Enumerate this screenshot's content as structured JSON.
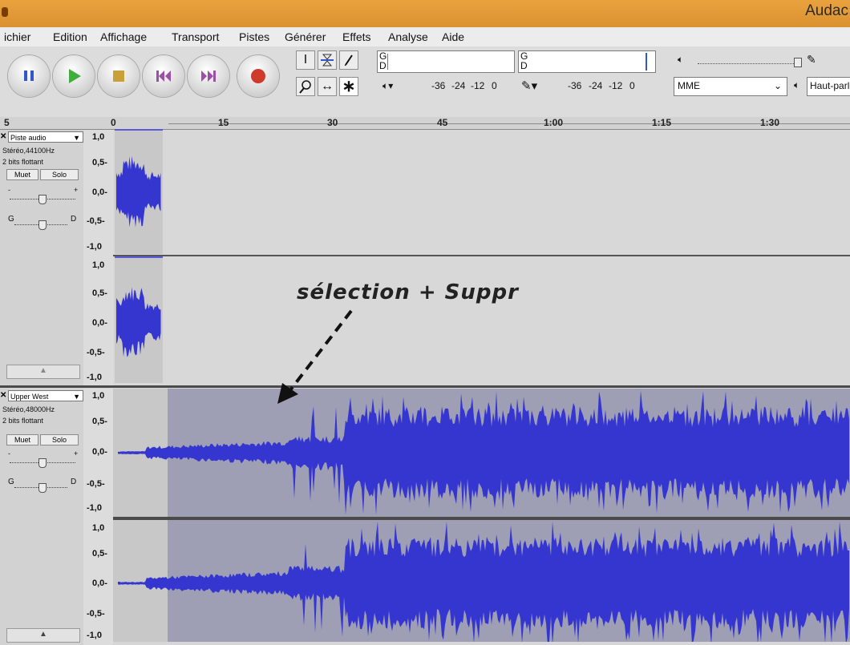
{
  "window": {
    "title": "Audac"
  },
  "menu": [
    "ichier",
    "Edition",
    "Affichage",
    "Transport",
    "Pistes",
    "Générer",
    "Effets",
    "Analyse",
    "Aide"
  ],
  "meter": {
    "ticks_play": [
      "-36",
      "-24",
      "-12",
      "0"
    ],
    "ticks_record": [
      "-36",
      "-24",
      "-12",
      "0"
    ],
    "channel_g": "G",
    "channel_d": "D"
  },
  "device": {
    "host": "MME",
    "output": "Haut-parleu"
  },
  "ruler": [
    "5",
    "0",
    "15",
    "30",
    "45",
    "1:00",
    "1:15",
    "1:30"
  ],
  "scale_labels": [
    "1,0",
    "0,5-",
    "0,0-",
    "-0,5-",
    "-1,0"
  ],
  "tracks": [
    {
      "name": "Piste audio",
      "info1": "Stéréo,44100Hz",
      "info2": "2 bits flottant",
      "mute": "Muet",
      "solo": "Solo",
      "gain_minus": "-",
      "gain_plus": "+",
      "pan_left": "G",
      "pan_right": "D"
    },
    {
      "name": "Upper West",
      "info1": "Stéréo,48000Hz",
      "info2": "2 bits flottant",
      "mute": "Muet",
      "solo": "Solo",
      "gain_minus": "-",
      "gain_plus": "+",
      "pan_left": "G",
      "pan_right": "D"
    }
  ],
  "annotation": {
    "text": "sélection + Suppr"
  },
  "colors": {
    "waveform": "#3535d0",
    "titlebar": "#e09a36",
    "selection": "#9e9eb4"
  }
}
